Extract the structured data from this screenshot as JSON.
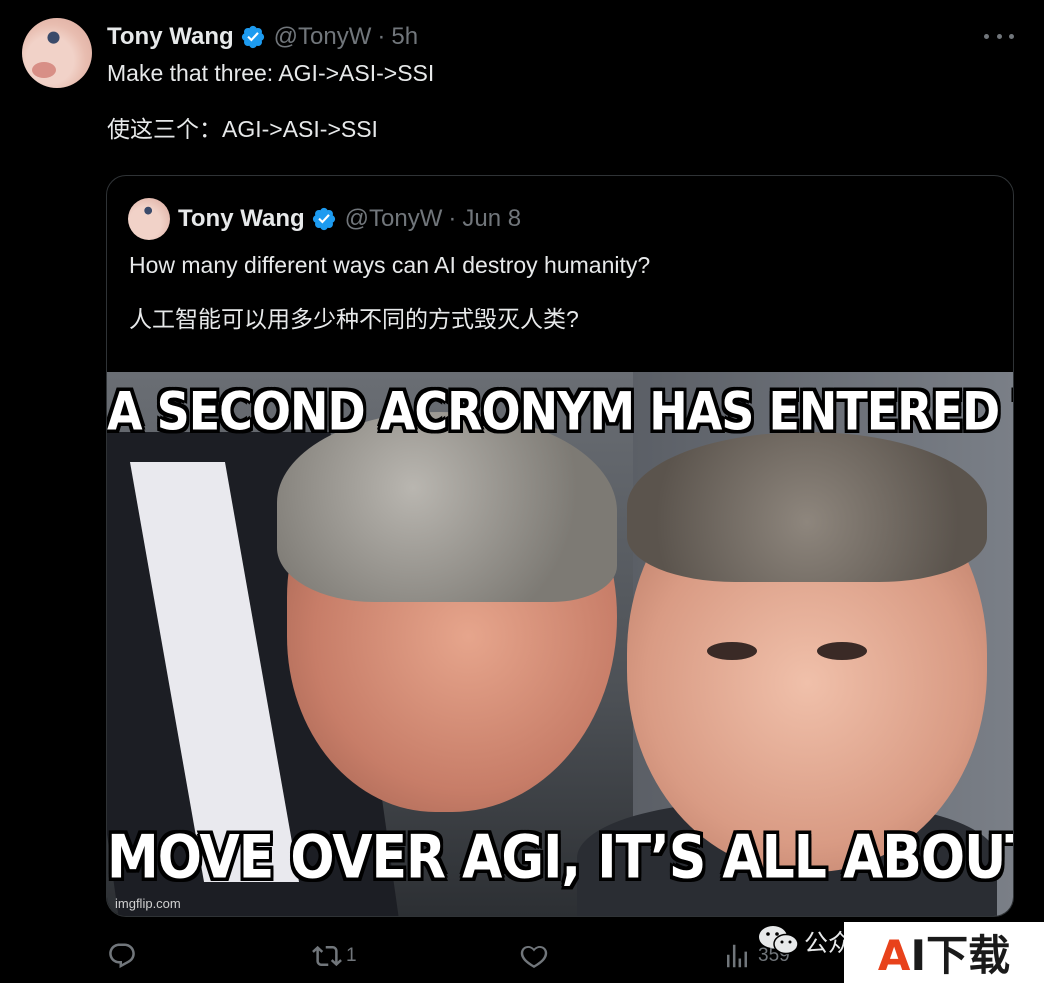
{
  "tweet": {
    "author_name": "Tony Wang",
    "handle": "@TonyW",
    "separator": "·",
    "time": "5h",
    "text_en": "Make that three: AGI->ASI->SSI",
    "text_zh": "使这三个：AGI->ASI->SSI"
  },
  "quoted": {
    "author_name": "Tony Wang",
    "handle": "@TonyW",
    "separator": "·",
    "date": "Jun 8",
    "text_en": "How many different ways can AI destroy humanity?",
    "text_zh": "人工智能可以用多少种不同的方式毁灭人类?",
    "meme": {
      "caption_top": "A SECOND ACRONYM HAS ENTERED THE CHAT",
      "caption_bottom": "MOVE OVER AGI, IT’S ALL ABOUT ASI",
      "credit": "imgflip.com"
    }
  },
  "actions": {
    "reply_icon": "reply-icon",
    "retweet_icon": "retweet-icon",
    "retweet_count": "1",
    "like_icon": "heart-icon",
    "views_icon": "views-icon",
    "views_count": "359"
  },
  "watermark": {
    "wechat_text": "公众",
    "brand_a": "A",
    "brand_rest": "I下载"
  },
  "colors": {
    "background": "#000000",
    "text": "#e7e9ea",
    "muted": "#71767b",
    "verified": "#1d9bf0",
    "border": "#2f3336"
  }
}
